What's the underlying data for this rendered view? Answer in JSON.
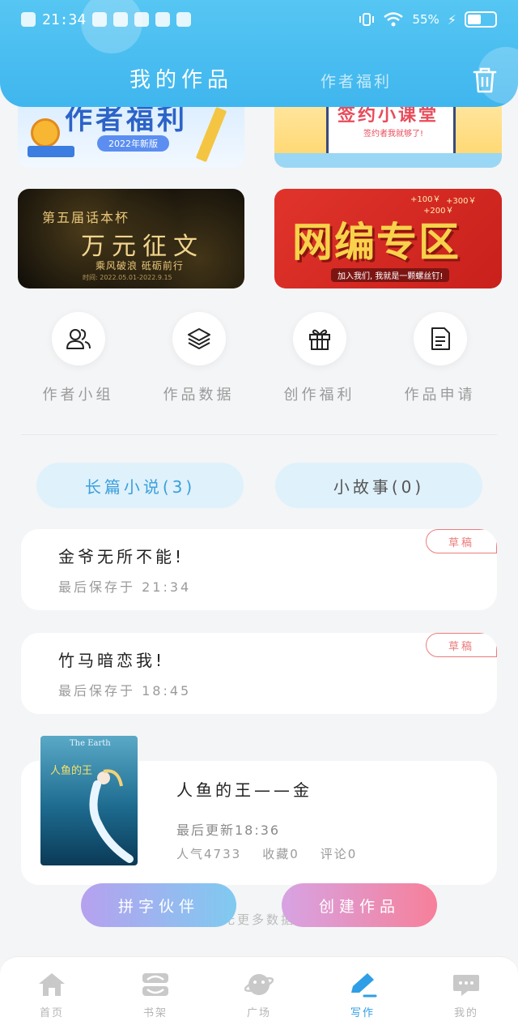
{
  "status_bar": {
    "time": "21:34",
    "battery": "55%",
    "battery_level": 0.55
  },
  "header": {
    "tab_active": "我的作品",
    "tab_inactive": "作者福利"
  },
  "banners": {
    "b1": {
      "title": "作者福利",
      "tag": "2022年新版"
    },
    "b2": {
      "title": "签约小课堂",
      "sub": "签约者我就够了!"
    },
    "b3": {
      "line1": "第五届话本杯",
      "title": "万元征文",
      "sub": "乘风破浪 砥砺前行",
      "date": "时间: 2022.05.01-2022.9.15"
    },
    "b4": {
      "title": "网编专区",
      "sub": "加入我们, 我就是一颗螺丝钉!",
      "bubbles": [
        "+100￥",
        "+300￥",
        "+200￥"
      ]
    }
  },
  "quick_actions": [
    {
      "label": "作者小组",
      "icon": "users-icon"
    },
    {
      "label": "作品数据",
      "icon": "layers-icon"
    },
    {
      "label": "创作福利",
      "icon": "gift-icon"
    },
    {
      "label": "作品申请",
      "icon": "document-icon"
    }
  ],
  "categories": {
    "long": "长篇小说(3)",
    "short": "小故事(0)"
  },
  "drafts": [
    {
      "title": "金爷无所不能!",
      "saved": "最后保存于 21:34",
      "tag": "草稿"
    },
    {
      "title": "竹马暗恋我!",
      "saved": "最后保存于 18:45",
      "tag": "草稿"
    }
  ],
  "work": {
    "cover_title": "The Earth",
    "cover_sub": "人鱼的王",
    "title": "人鱼的王——金",
    "updated": "最后更新18:36",
    "popularity": "人气4733",
    "favorites": "收藏0",
    "comments": "评论0"
  },
  "no_more": "无更多数据",
  "buttons": {
    "partner": "拼字伙伴",
    "create": "创建作品"
  },
  "bottom_nav": [
    {
      "label": "首页",
      "icon": "home-icon"
    },
    {
      "label": "书架",
      "icon": "bookshelf-icon"
    },
    {
      "label": "广场",
      "icon": "planet-icon"
    },
    {
      "label": "写作",
      "icon": "pen-icon",
      "active": true
    },
    {
      "label": "我的",
      "icon": "chat-icon"
    }
  ],
  "colors": {
    "header": "#4cbdf1",
    "accent": "#2f9ee6",
    "draft_tag": "#ec7c7c"
  }
}
